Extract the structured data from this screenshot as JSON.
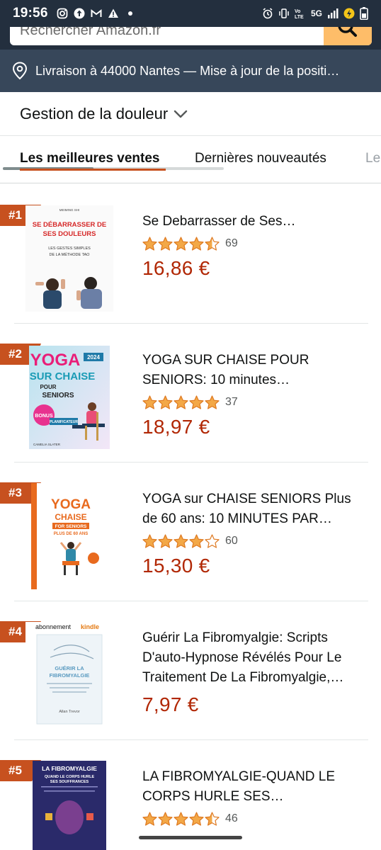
{
  "status_bar": {
    "time": "19:56",
    "network": "5G"
  },
  "search": {
    "placeholder": "Rechercher Amazon.fr"
  },
  "delivery": {
    "text": "Livraison à 44000 Nantes — Mise à jour de la positi…"
  },
  "category": {
    "title": "Gestion de la douleur"
  },
  "tabs": [
    {
      "label": "Les meilleures ventes"
    },
    {
      "label": "Dernières nouveautés"
    },
    {
      "label": "Le"
    }
  ],
  "colors": {
    "header": "#232f3e",
    "delivery": "#37475a",
    "accent": "#c7511f",
    "price": "#b12704",
    "star": "#f3a847"
  },
  "products": [
    {
      "rank": "#1",
      "title": "Se Debarrasser de Ses…",
      "title2": "",
      "title3": "",
      "rating": 4.5,
      "reviews": "69",
      "price": "16,86 €",
      "cover": {
        "author": "MEIMING SHI",
        "line1": "SE DÉBARRASSER DE",
        "line2": "SES DOULEURS",
        "sub1": "LES GESTES SIMPLES",
        "sub2": "DE LA MÉTHODE TAO"
      }
    },
    {
      "rank": "#2",
      "title": "YOGA SUR CHAISE POUR",
      "title2": "SENIORS: 10 minutes…",
      "title3": "",
      "rating": 5,
      "reviews": "37",
      "price": "18,97 €",
      "cover": {
        "line1": "YOGA",
        "line2": "SUR CHAISE",
        "line3": "POUR",
        "line4": "SENIORS",
        "year": "2024",
        "bonus": "BONUS",
        "planner": "PLANIFICATEUR",
        "author": "CAMELIA SLATER"
      }
    },
    {
      "rank": "#3",
      "title": "YOGA sur CHAISE SENIORS Plus",
      "title2": "de 60 ans: 10 MINUTES PAR…",
      "title3": "",
      "rating": 4,
      "reviews": "60",
      "price": "15,30 €",
      "cover": {
        "line1": "YOGA",
        "line2": "CHAISE",
        "line3": "FOR SENIORS",
        "line4": "PLUS DE 60 ANS"
      }
    },
    {
      "rank": "#4",
      "title": "Guérir La Fibromyalgie: Scripts",
      "title2": "D'auto-Hypnose Révélés Pour Le",
      "title3": "Traitement De La Fibromyalgie,…",
      "rating": null,
      "reviews": "",
      "price": "7,97 €",
      "cover": {
        "kindle_a": "abonnement",
        "kindle_b": "kindle",
        "line1": "GUÉRIR LA",
        "line2": "FIBROMYALGIE",
        "author": "Allan Trevor"
      }
    },
    {
      "rank": "#5",
      "title": "LA FIBROMYALGIE-QUAND LE",
      "title2": "CORPS HURLE SES…",
      "title3": "",
      "rating": 4.5,
      "reviews": "46",
      "price": "",
      "cover": {
        "line1": "LA FIBROMYALGIE",
        "line2": "QUAND LE CORPS HURLE",
        "line3": "SES SOUFFRANCES"
      }
    }
  ]
}
